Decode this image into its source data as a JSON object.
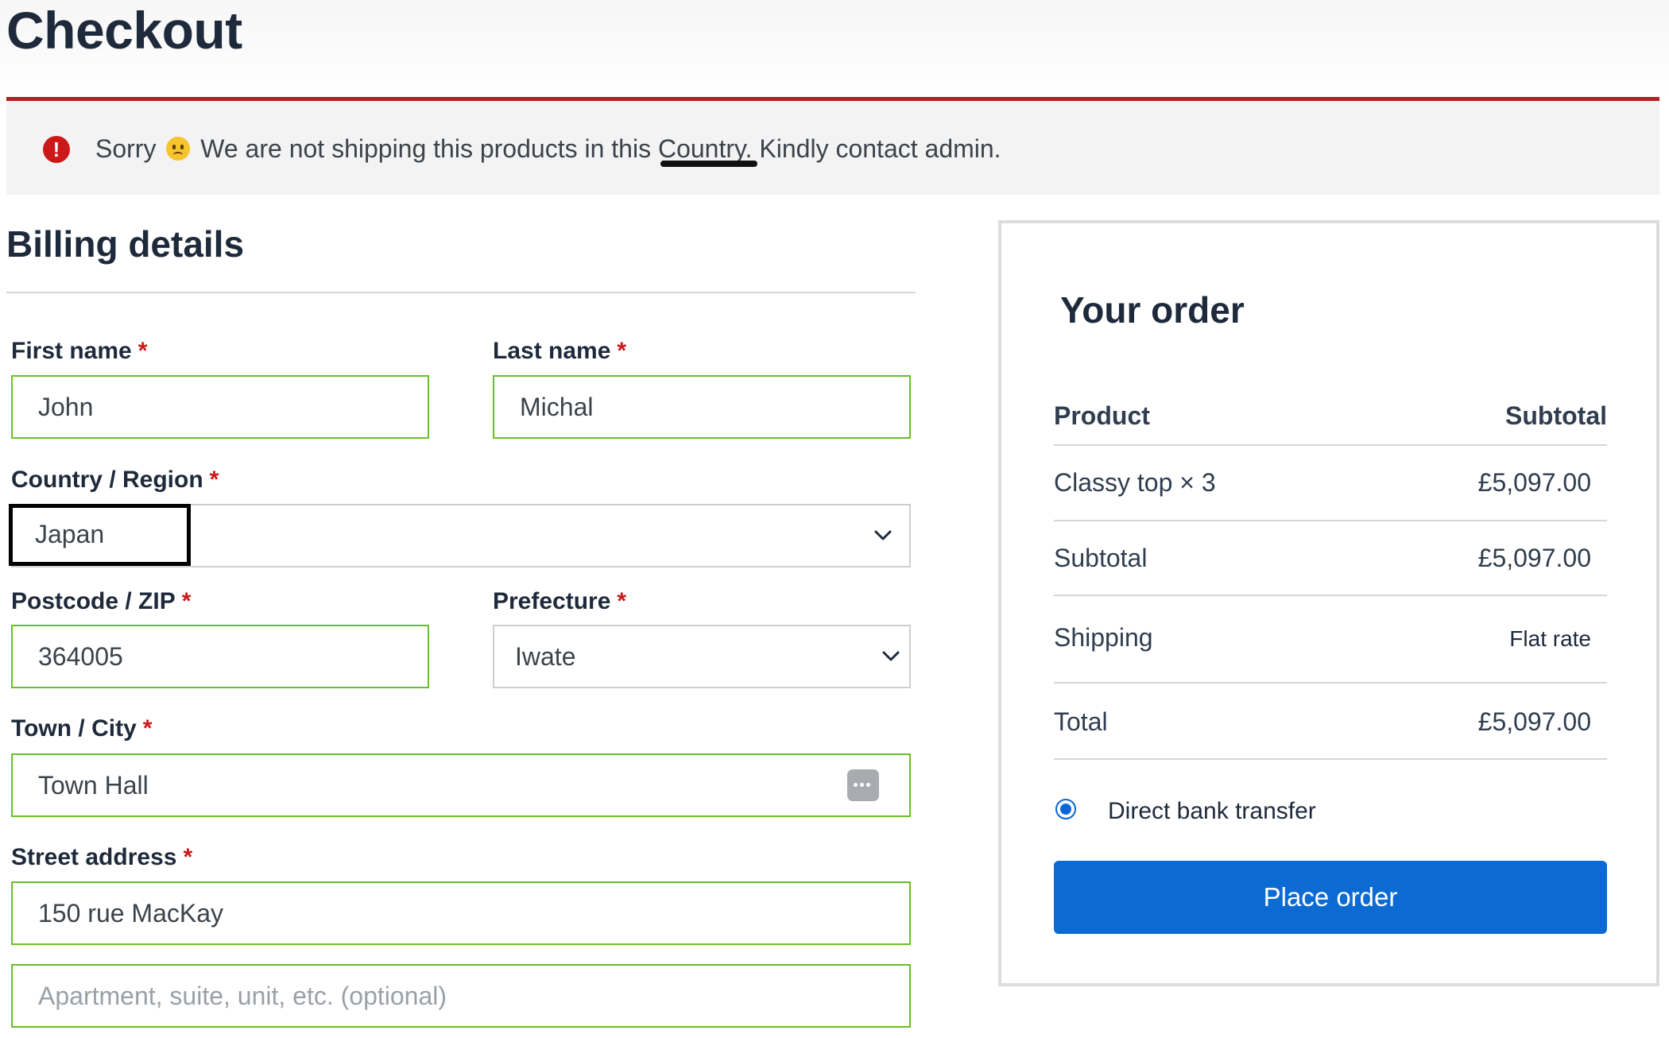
{
  "page": {
    "title": "Checkout"
  },
  "notice": {
    "before": "Sorry",
    "after": "We are not shipping this products in this Country. Kindly contact admin.",
    "icon": "exclamation-icon",
    "accent": "#b81c23"
  },
  "billing": {
    "heading": "Billing details",
    "required_mark": "*",
    "first_name": {
      "label": "First name",
      "value": "John"
    },
    "last_name": {
      "label": "Last name",
      "value": "Michal"
    },
    "country": {
      "label": "Country / Region",
      "value": "Japan"
    },
    "postcode": {
      "label": "Postcode / ZIP",
      "value": "364005"
    },
    "prefecture": {
      "label": "Prefecture",
      "value": "Iwate"
    },
    "city": {
      "label": "Town / City",
      "value": "Town Hall"
    },
    "street": {
      "label": "Street address",
      "value": "150 rue MacKay",
      "line2_placeholder": "Apartment, suite, unit, etc. (optional)"
    },
    "valid_color": "#69bf29"
  },
  "order": {
    "heading": "Your order",
    "col_product": "Product",
    "col_subtotal": "Subtotal",
    "item": {
      "name": "Classy top × 3",
      "price": "£5,097.00"
    },
    "subtotal": {
      "label": "Subtotal",
      "value": "£5,097.00"
    },
    "shipping": {
      "label": "Shipping",
      "value": "Flat rate"
    },
    "total": {
      "label": "Total",
      "value": "£5,097.00"
    },
    "payment_method": "Direct bank transfer",
    "place_order": "Place order",
    "button_color": "#0b6bd3"
  }
}
